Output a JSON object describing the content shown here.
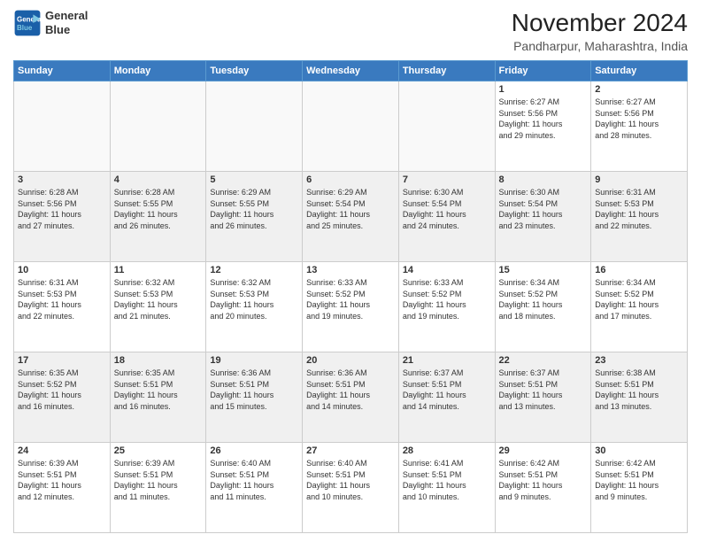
{
  "header": {
    "logo_line1": "General",
    "logo_line2": "Blue",
    "main_title": "November 2024",
    "subtitle": "Pandharpur, Maharashtra, India"
  },
  "calendar": {
    "days_of_week": [
      "Sunday",
      "Monday",
      "Tuesday",
      "Wednesday",
      "Thursday",
      "Friday",
      "Saturday"
    ],
    "weeks": [
      [
        {
          "day": "",
          "info": ""
        },
        {
          "day": "",
          "info": ""
        },
        {
          "day": "",
          "info": ""
        },
        {
          "day": "",
          "info": ""
        },
        {
          "day": "",
          "info": ""
        },
        {
          "day": "1",
          "info": "Sunrise: 6:27 AM\nSunset: 5:56 PM\nDaylight: 11 hours\nand 29 minutes."
        },
        {
          "day": "2",
          "info": "Sunrise: 6:27 AM\nSunset: 5:56 PM\nDaylight: 11 hours\nand 28 minutes."
        }
      ],
      [
        {
          "day": "3",
          "info": "Sunrise: 6:28 AM\nSunset: 5:56 PM\nDaylight: 11 hours\nand 27 minutes."
        },
        {
          "day": "4",
          "info": "Sunrise: 6:28 AM\nSunset: 5:55 PM\nDaylight: 11 hours\nand 26 minutes."
        },
        {
          "day": "5",
          "info": "Sunrise: 6:29 AM\nSunset: 5:55 PM\nDaylight: 11 hours\nand 26 minutes."
        },
        {
          "day": "6",
          "info": "Sunrise: 6:29 AM\nSunset: 5:54 PM\nDaylight: 11 hours\nand 25 minutes."
        },
        {
          "day": "7",
          "info": "Sunrise: 6:30 AM\nSunset: 5:54 PM\nDaylight: 11 hours\nand 24 minutes."
        },
        {
          "day": "8",
          "info": "Sunrise: 6:30 AM\nSunset: 5:54 PM\nDaylight: 11 hours\nand 23 minutes."
        },
        {
          "day": "9",
          "info": "Sunrise: 6:31 AM\nSunset: 5:53 PM\nDaylight: 11 hours\nand 22 minutes."
        }
      ],
      [
        {
          "day": "10",
          "info": "Sunrise: 6:31 AM\nSunset: 5:53 PM\nDaylight: 11 hours\nand 22 minutes."
        },
        {
          "day": "11",
          "info": "Sunrise: 6:32 AM\nSunset: 5:53 PM\nDaylight: 11 hours\nand 21 minutes."
        },
        {
          "day": "12",
          "info": "Sunrise: 6:32 AM\nSunset: 5:53 PM\nDaylight: 11 hours\nand 20 minutes."
        },
        {
          "day": "13",
          "info": "Sunrise: 6:33 AM\nSunset: 5:52 PM\nDaylight: 11 hours\nand 19 minutes."
        },
        {
          "day": "14",
          "info": "Sunrise: 6:33 AM\nSunset: 5:52 PM\nDaylight: 11 hours\nand 19 minutes."
        },
        {
          "day": "15",
          "info": "Sunrise: 6:34 AM\nSunset: 5:52 PM\nDaylight: 11 hours\nand 18 minutes."
        },
        {
          "day": "16",
          "info": "Sunrise: 6:34 AM\nSunset: 5:52 PM\nDaylight: 11 hours\nand 17 minutes."
        }
      ],
      [
        {
          "day": "17",
          "info": "Sunrise: 6:35 AM\nSunset: 5:52 PM\nDaylight: 11 hours\nand 16 minutes."
        },
        {
          "day": "18",
          "info": "Sunrise: 6:35 AM\nSunset: 5:51 PM\nDaylight: 11 hours\nand 16 minutes."
        },
        {
          "day": "19",
          "info": "Sunrise: 6:36 AM\nSunset: 5:51 PM\nDaylight: 11 hours\nand 15 minutes."
        },
        {
          "day": "20",
          "info": "Sunrise: 6:36 AM\nSunset: 5:51 PM\nDaylight: 11 hours\nand 14 minutes."
        },
        {
          "day": "21",
          "info": "Sunrise: 6:37 AM\nSunset: 5:51 PM\nDaylight: 11 hours\nand 14 minutes."
        },
        {
          "day": "22",
          "info": "Sunrise: 6:37 AM\nSunset: 5:51 PM\nDaylight: 11 hours\nand 13 minutes."
        },
        {
          "day": "23",
          "info": "Sunrise: 6:38 AM\nSunset: 5:51 PM\nDaylight: 11 hours\nand 13 minutes."
        }
      ],
      [
        {
          "day": "24",
          "info": "Sunrise: 6:39 AM\nSunset: 5:51 PM\nDaylight: 11 hours\nand 12 minutes."
        },
        {
          "day": "25",
          "info": "Sunrise: 6:39 AM\nSunset: 5:51 PM\nDaylight: 11 hours\nand 11 minutes."
        },
        {
          "day": "26",
          "info": "Sunrise: 6:40 AM\nSunset: 5:51 PM\nDaylight: 11 hours\nand 11 minutes."
        },
        {
          "day": "27",
          "info": "Sunrise: 6:40 AM\nSunset: 5:51 PM\nDaylight: 11 hours\nand 10 minutes."
        },
        {
          "day": "28",
          "info": "Sunrise: 6:41 AM\nSunset: 5:51 PM\nDaylight: 11 hours\nand 10 minutes."
        },
        {
          "day": "29",
          "info": "Sunrise: 6:42 AM\nSunset: 5:51 PM\nDaylight: 11 hours\nand 9 minutes."
        },
        {
          "day": "30",
          "info": "Sunrise: 6:42 AM\nSunset: 5:51 PM\nDaylight: 11 hours\nand 9 minutes."
        }
      ]
    ]
  }
}
